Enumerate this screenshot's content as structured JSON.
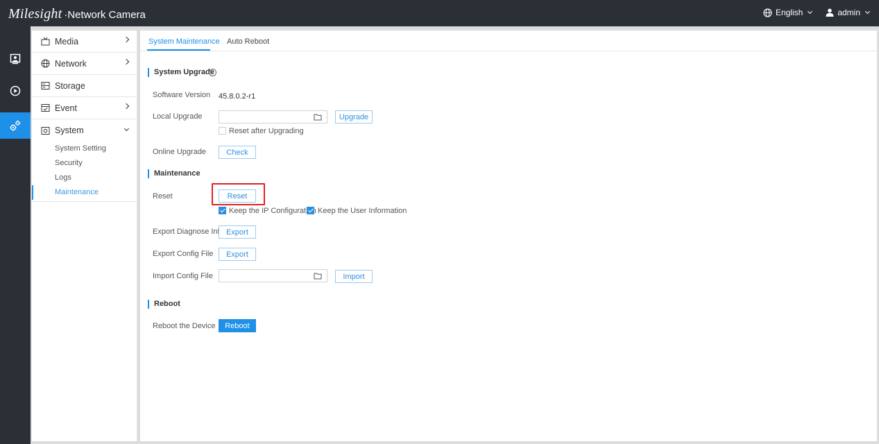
{
  "app": {
    "brand": "Milesight",
    "product": "·Network Camera",
    "language": "English",
    "user": "admin"
  },
  "rail": [
    {
      "name": "live-view-icon",
      "active": false
    },
    {
      "name": "playback-icon",
      "active": false
    },
    {
      "name": "settings-icon",
      "active": true
    }
  ],
  "menu": {
    "items": [
      {
        "label": "Media"
      },
      {
        "label": "Network"
      },
      {
        "label": "Storage"
      },
      {
        "label": "Event"
      },
      {
        "label": "System"
      }
    ],
    "system_sub": [
      {
        "label": "System Setting"
      },
      {
        "label": "Security"
      },
      {
        "label": "Logs"
      },
      {
        "label": "Maintenance",
        "active": true
      }
    ]
  },
  "tabs": [
    {
      "label": "System Maintenance",
      "active": true
    },
    {
      "label": "Auto Reboot",
      "active": false
    }
  ],
  "upgrade": {
    "title": "System Upgrade",
    "software_version_label": "Software Version",
    "software_version": "45.8.0.2-r1",
    "local_upgrade_label": "Local Upgrade",
    "local_upgrade_value": "",
    "upgrade_button": "Upgrade",
    "reset_after_label": "Reset after Upgrading",
    "reset_after_checked": false,
    "online_upgrade_label": "Online Upgrade",
    "check_button": "Check"
  },
  "maintenance": {
    "title": "Maintenance",
    "reset_label": "Reset",
    "reset_button": "Reset",
    "keep_ip_label": "Keep the IP Configuration",
    "keep_ip_checked": true,
    "keep_user_label": "Keep the User Information",
    "keep_user_checked": true,
    "export_diag_label": "Export Diagnose Info",
    "export_diag_button": "Export",
    "export_config_label": "Export Config File",
    "export_config_button": "Export",
    "import_config_label": "Import Config File",
    "import_config_value": "",
    "import_button": "Import"
  },
  "reboot": {
    "title": "Reboot",
    "reboot_label": "Reboot the Device",
    "reboot_button": "Reboot"
  },
  "colors": {
    "accent": "#1e90e8",
    "topbar": "#2b2f36",
    "highlight": "#e02020"
  }
}
